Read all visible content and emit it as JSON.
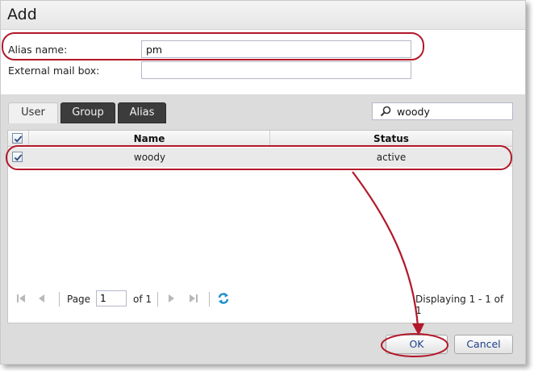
{
  "dialog": {
    "title": "Add"
  },
  "form": {
    "alias_name_label": "Alias name:",
    "alias_name_value": "pm",
    "external_mailbox_label": "External mail box:",
    "external_mailbox_value": ""
  },
  "tabs": [
    {
      "label": "User",
      "active": true
    },
    {
      "label": "Group",
      "active": false
    },
    {
      "label": "Alias",
      "active": false
    }
  ],
  "search": {
    "value": "woody",
    "icon": "search-icon"
  },
  "grid": {
    "columns": [
      "Name",
      "Status"
    ],
    "header_checked": true,
    "rows": [
      {
        "checked": true,
        "name": "woody",
        "status": "active"
      }
    ]
  },
  "paging": {
    "page_label": "Page",
    "current_page": "1",
    "of_label": "of 1",
    "display_info": "Displaying 1 - 1 of 1"
  },
  "buttons": {
    "ok": "OK",
    "cancel": "Cancel"
  },
  "colors": {
    "annotation": "#b3182a",
    "accent_text": "#1c3f8a",
    "refresh": "#1a8fd0"
  }
}
